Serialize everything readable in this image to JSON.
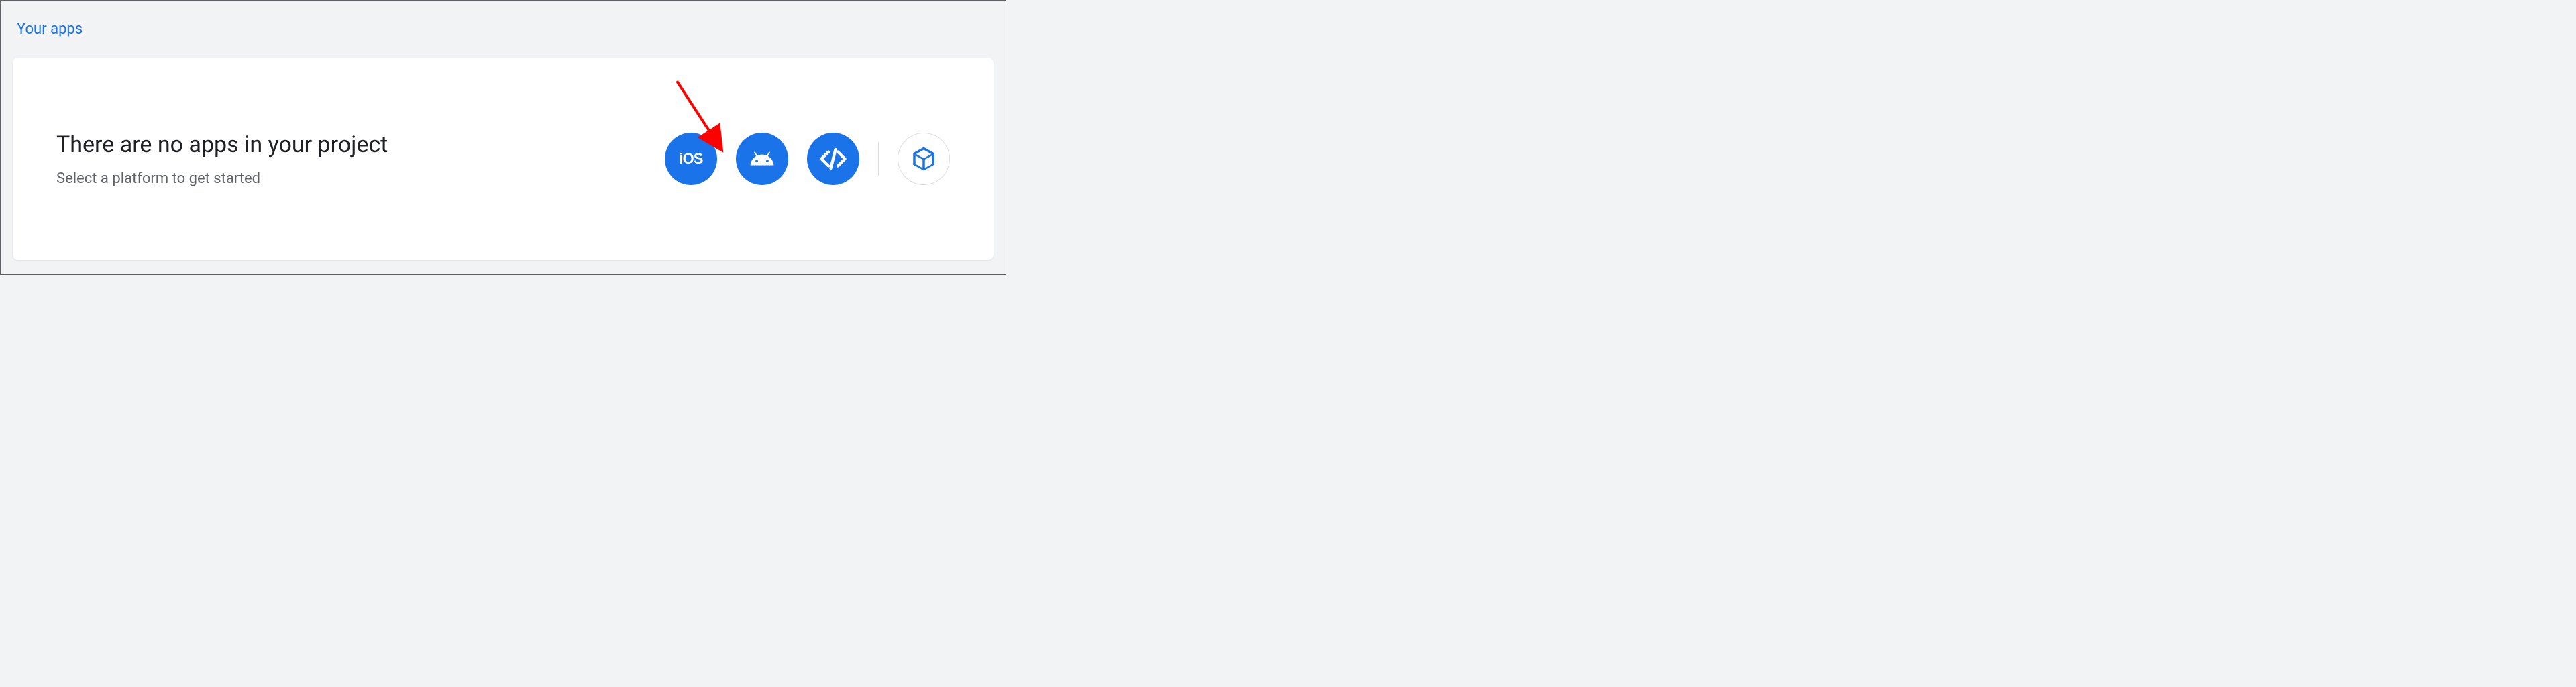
{
  "section": {
    "title": "Your apps"
  },
  "card": {
    "heading": "There are no apps in your project",
    "subtitle": "Select a platform to get started"
  },
  "platforms": {
    "ios_label": "iOS",
    "android_name": "android",
    "web_name": "web",
    "unity_name": "unity"
  },
  "colors": {
    "primary": "#1a73e8",
    "text_dark": "#202124",
    "text_muted": "#5f6368",
    "background": "#f1f3f4",
    "arrow": "#ff0000"
  }
}
